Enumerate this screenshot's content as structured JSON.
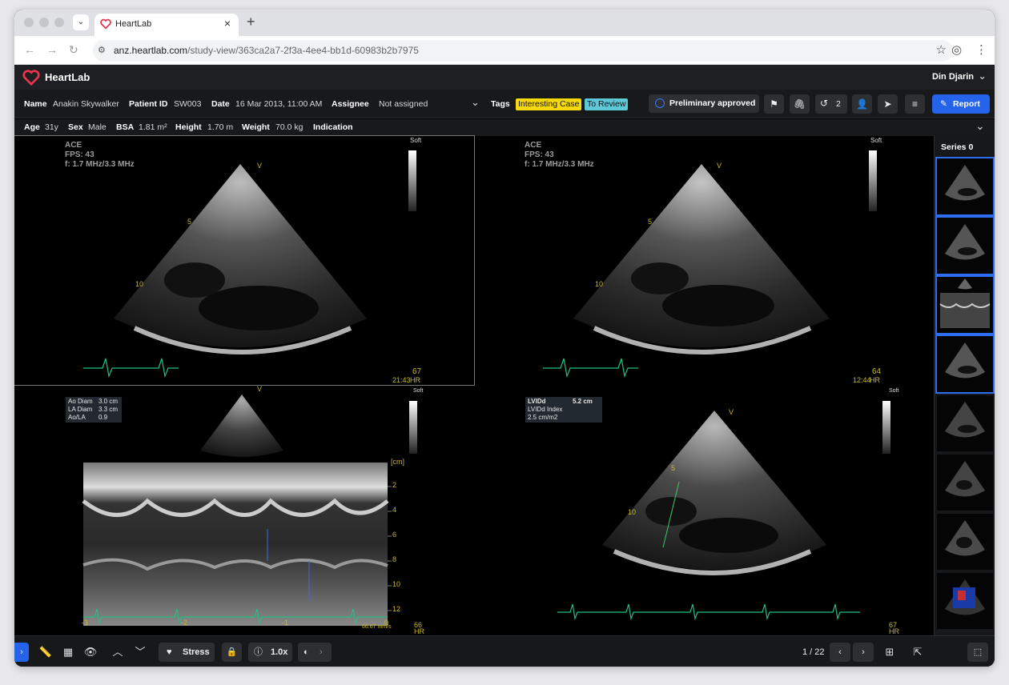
{
  "browser": {
    "tab_title": "HeartLab",
    "url_host": "anz.heartlab.com",
    "url_path": "/study-view/363ca2a7-2f3a-4ee4-bb1d-60983b2b7975"
  },
  "app": {
    "brand": "HeartLab",
    "user": "Din Djarin",
    "accent": "#2563eb",
    "brand_color": "#e8344e"
  },
  "patient": {
    "name_label": "Name",
    "name": "Anakin Skywalker",
    "pid_label": "Patient ID",
    "pid": "SW003",
    "date_label": "Date",
    "date": "16 Mar 2013, 11:00 AM",
    "assignee_label": "Assignee",
    "assignee": "Not assigned",
    "tags_label": "Tags",
    "tags": [
      {
        "label": "Interesting Case",
        "color": "#f5d90a"
      },
      {
        "label": "To Review",
        "color": "#5cc8d8"
      }
    ],
    "status": "Preliminary approved",
    "history_count": "2",
    "report_label": "Report",
    "age_label": "Age",
    "age": "31y",
    "sex_label": "Sex",
    "sex": "Male",
    "bsa_label": "BSA",
    "bsa": "1.81 m²",
    "height_label": "Height",
    "height": "1.70 m",
    "weight_label": "Weight",
    "weight": "70.0 kg",
    "indication_label": "Indication"
  },
  "panels": [
    {
      "preset": "ACE",
      "fps": "FPS: 43",
      "freq": "f: 1.7 MHz/3.3 MHz",
      "soft": "Soft",
      "depth_a": "5",
      "depth_b": "10",
      "hr": "67",
      "time": "21:43",
      "hr_unit": "HR"
    },
    {
      "preset": "ACE",
      "fps": "FPS: 43",
      "freq": "f: 1.7 MHz/3.3 MHz",
      "soft": "Soft",
      "depth_a": "5",
      "depth_b": "10",
      "hr": "64",
      "time": "12:44",
      "hr_unit": "HR"
    },
    {
      "soft": "Soft",
      "hr": "66",
      "hr_unit": "HR",
      "speed": "66.67 mm/s",
      "unit": "[cm]",
      "scale": [
        "2",
        "4",
        "6",
        "8",
        "10",
        "12"
      ],
      "ticks": [
        "-3",
        "-2",
        "-1",
        "0"
      ],
      "measurements": [
        {
          "label": "Ao Diam",
          "value": "3.0 cm"
        },
        {
          "label": "LA Diam",
          "value": "3.3 cm"
        },
        {
          "label": "Ao/LA",
          "value": "0.9"
        }
      ]
    },
    {
      "soft": "Soft",
      "hr": "67",
      "hr_unit": "HR",
      "depth_a": "5",
      "depth_b": "10",
      "measurements": [
        {
          "label": "LVIDd",
          "value": "5.2 cm"
        },
        {
          "label": "LVIDd Index",
          "value": "2.5 cm/m2"
        }
      ]
    }
  ],
  "sidebar": {
    "title": "Series 0",
    "thumb_count": 8
  },
  "toolbar": {
    "stress_label": "Stress",
    "speed_label": "1.0x",
    "pager": "1 / 22"
  }
}
